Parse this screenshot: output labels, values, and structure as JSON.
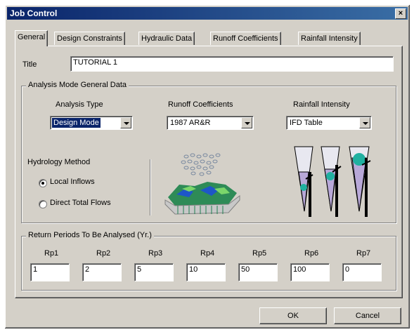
{
  "window": {
    "title": "Job Control",
    "close_glyph": "×"
  },
  "tabs": [
    {
      "label": "General"
    },
    {
      "label": "Design Constraints"
    },
    {
      "label": "Hydraulic Data"
    },
    {
      "label": "Runoff Coefficients"
    },
    {
      "label": "Rainfall Intensity"
    }
  ],
  "general": {
    "title_label": "Title",
    "title_value": "TUTORIAL 1",
    "analysis_group": "Analysis Mode General Data",
    "analysis_type_label": "Analysis Type",
    "analysis_type_value": "Design Mode",
    "runoff_label": "Runoff Coefficients",
    "runoff_value": "1987 AR&R",
    "rainfall_label": "Rainfall Intensity",
    "rainfall_value": "IFD Table",
    "hydrology_label": "Hydrology Method",
    "hydrology_options": [
      {
        "label": "Local Inflows",
        "selected": true
      },
      {
        "label": "Direct Total Flows",
        "selected": false
      }
    ],
    "return_group": "Return Periods To Be Analysed (Yr.)",
    "return_periods": [
      {
        "label": "Rp1",
        "value": "1"
      },
      {
        "label": "Rp2",
        "value": "2"
      },
      {
        "label": "Rp3",
        "value": "5"
      },
      {
        "label": "Rp4",
        "value": "10"
      },
      {
        "label": "Rp5",
        "value": "50"
      },
      {
        "label": "Rp6",
        "value": "100"
      },
      {
        "label": "Rp7",
        "value": "0"
      }
    ]
  },
  "buttons": {
    "ok": "OK",
    "cancel": "Cancel"
  },
  "icons": {
    "rain": "rain-catchment-icon",
    "tubes": "rain-gauge-tubes-icon"
  },
  "colors": {
    "title_start": "#0a246a",
    "title_end": "#3a6ea5",
    "face": "#d4d0c8",
    "selection": "#0a246a"
  }
}
